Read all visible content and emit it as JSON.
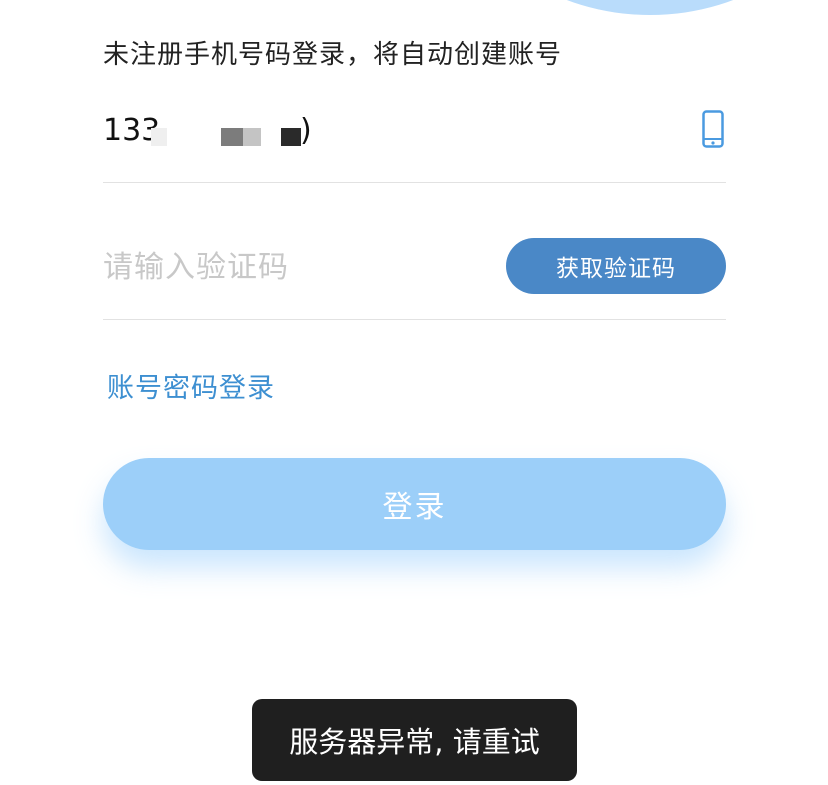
{
  "form": {
    "hint": "未注册手机号码登录，将自动创建账号",
    "phone_value_visible": "133",
    "phone_value_tail": ")",
    "phone_icon": "mobile-phone-icon",
    "code_placeholder": "请输入验证码",
    "get_code_label": "获取验证码",
    "password_login_label": "账号密码登录",
    "login_label": "登录"
  },
  "toast": {
    "message": "服务器异常, 请重试"
  },
  "colors": {
    "accent": "#4a88c7",
    "link": "#3d8fd1",
    "login_button": "#9ccff9",
    "toast_bg": "#1f1f1f",
    "top_arc": "#b9dcfb"
  }
}
